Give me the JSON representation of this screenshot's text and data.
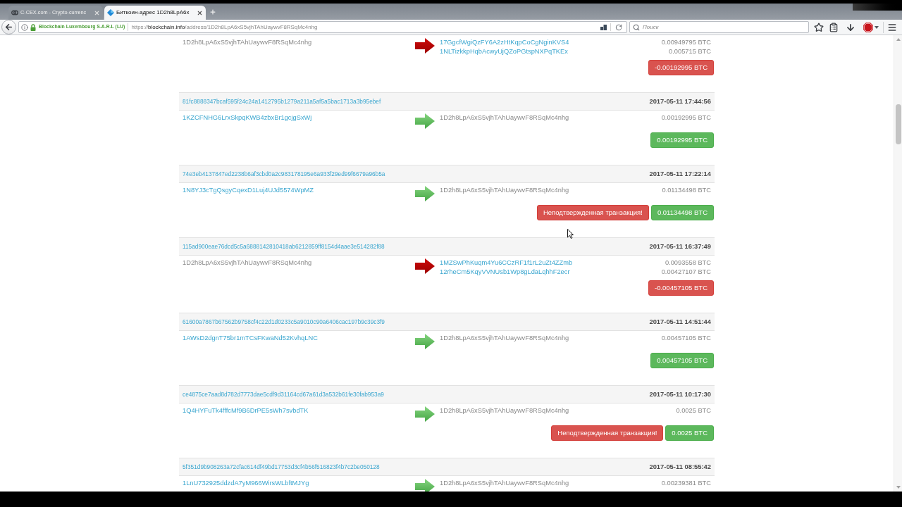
{
  "browser": {
    "tabs": [
      {
        "title": "C-CEX.com - Crypto-currenc",
        "selected": false
      },
      {
        "title": "Биткоин-адрес 1D2h8LpA6x",
        "selected": true
      }
    ],
    "identity": "Blockchain Luxembourg S.A.R.L (LU)",
    "url": {
      "prefix": "https://",
      "host": "blockchain.info",
      "path": "/address/1D2h8LpA6xS5vjhTAhUaywvF8RSqMc4nhg"
    },
    "search": {
      "placeholder": "Поиск"
    }
  },
  "transactions": [
    {
      "kind": "sent",
      "inputs": [
        {
          "address": "1D2h8LpA6xS5vjhTAhUaywvF8RSqMc4nhg",
          "own": true
        }
      ],
      "outputs": [
        {
          "address": "17GgcfWgiQzFY6A2zHtKqpCoCgNginKVS4",
          "own": false
        },
        {
          "address": "1NLTizkkpHqbAcwyUjQZoPGtspNXPqTKEx",
          "own": false
        }
      ],
      "amounts": [
        "0.00949795 BTC",
        "0.005715 BTC"
      ],
      "badges": [
        {
          "kind": "danger",
          "text": "-0.00192995 BTC"
        }
      ]
    },
    {
      "hash": "81fc8888347bcaf595f24c24a1412795b1279a211a5af5a5bac1713a3b95ebef",
      "time": "2017-05-11 17:44:56",
      "kind": "received",
      "inputs": [
        {
          "address": "1KZCFNHG6LrxSkpqKWB4zbxBr1gcjgSxWj",
          "own": false
        }
      ],
      "outputs": [
        {
          "address": "1D2h8LpA6xS5vjhTAhUaywvF8RSqMc4nhg",
          "own": true
        }
      ],
      "amounts": [
        "0.00192995 BTC"
      ],
      "badges": [
        {
          "kind": "success",
          "text": "0.00192995 BTC"
        }
      ]
    },
    {
      "hash": "74e3eb4137847ed2238b6af3cbd0a2c983178195e6a933f29ed99f6679a96b5a",
      "time": "2017-05-11 17:22:14",
      "kind": "received",
      "inputs": [
        {
          "address": "1N8YJ3cTgQsgyCqexD1Luj4UJd5574WpMZ",
          "own": false
        }
      ],
      "outputs": [
        {
          "address": "1D2h8LpA6xS5vjhTAhUaywvF8RSqMc4nhg",
          "own": true
        }
      ],
      "amounts": [
        "0.01134498 BTC"
      ],
      "badges": [
        {
          "kind": "danger",
          "text": "Неподтвержденная транзакция!"
        },
        {
          "kind": "success",
          "text": "0.01134498 BTC"
        }
      ]
    },
    {
      "hash": "115ad900eae76dcd5c5a6888142810418ab6212859ff8154d4aae3e514282f88",
      "time": "2017-05-11 16:37:49",
      "kind": "sent",
      "inputs": [
        {
          "address": "1D2h8LpA6xS5vjhTAhUaywvF8RSqMc4nhg",
          "own": true
        }
      ],
      "outputs": [
        {
          "address": "1MZSwPhKuqm4Yu6CCzRF1f1rL2uZt4ZZmb",
          "own": false
        },
        {
          "address": "12rheCm5KqyVVNUsb1Wp8gLdaLqhhF2ecr",
          "own": false
        }
      ],
      "amounts": [
        "0.0093558 BTC",
        "0.00427107 BTC"
      ],
      "badges": [
        {
          "kind": "danger",
          "text": "-0.00457105 BTC"
        }
      ]
    },
    {
      "hash": "61600a7867b67562b9758cf4c22d1d0233c5a9010c90a6406cac197b9c39c3f9",
      "time": "2017-05-11 14:51:44",
      "kind": "received",
      "inputs": [
        {
          "address": "1AWsD2dgnT75br1mTCsFKwaNd52KvhqLNC",
          "own": false
        }
      ],
      "outputs": [
        {
          "address": "1D2h8LpA6xS5vjhTAhUaywvF8RSqMc4nhg",
          "own": true
        }
      ],
      "amounts": [
        "0.00457105 BTC"
      ],
      "badges": [
        {
          "kind": "success",
          "text": "0.00457105 BTC"
        }
      ]
    },
    {
      "hash": "ce4875ce7aad8d782d7773dae5cdf9d31164cd67a61d3a532b61fe30fab953a9",
      "time": "2017-05-11 10:17:30",
      "kind": "received",
      "inputs": [
        {
          "address": "1Q4HYFuTk4fffcMf9B6DrPE5sWh7svbdTK",
          "own": false
        }
      ],
      "outputs": [
        {
          "address": "1D2h8LpA6xS5vjhTAhUaywvF8RSqMc4nhg",
          "own": true
        }
      ],
      "amounts": [
        "0.0025 BTC"
      ],
      "badges": [
        {
          "kind": "danger",
          "text": "Неподтвержденная транзакция!"
        },
        {
          "kind": "success",
          "text": "0.0025 BTC"
        }
      ]
    },
    {
      "hash": "5f351d9b908263a72cfac614df49bd17753d3cf4b56f516823f4b7c2be050128",
      "time": "2017-05-11 08:55:42",
      "kind": "received",
      "inputs": [
        {
          "address": "1LnU732925ddzdA7yM966WirsWLbftMJYg",
          "own": false
        }
      ],
      "outputs": [
        {
          "address": "1D2h8LpA6xS5vjhTAhUaywvF8RSqMc4nhg",
          "own": true
        }
      ],
      "amounts": [
        "0.00239381 BTC"
      ]
    }
  ]
}
